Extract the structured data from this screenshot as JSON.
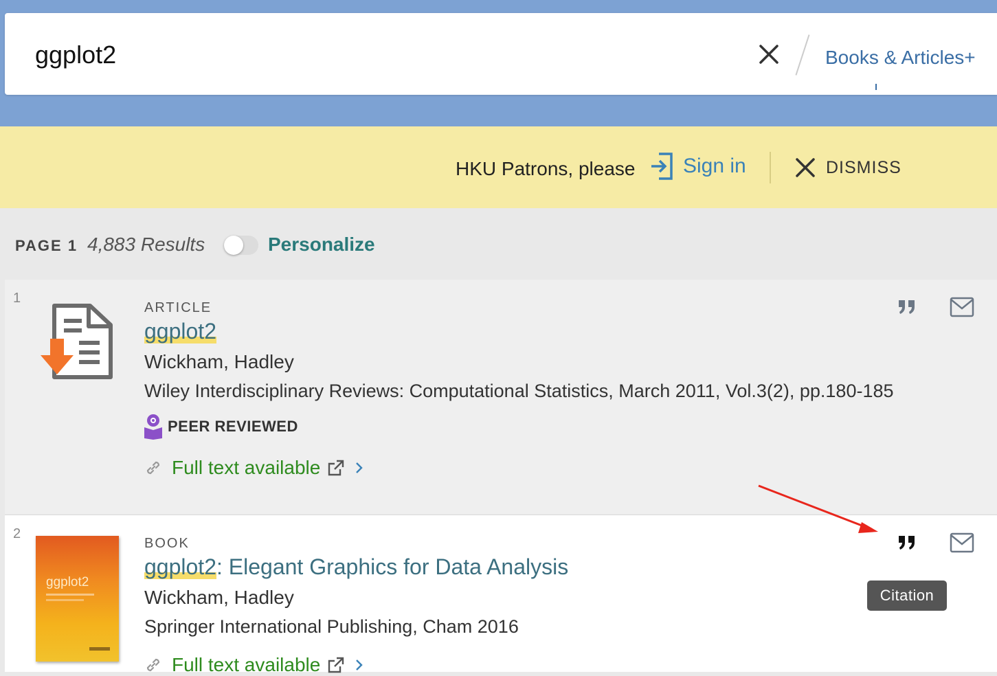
{
  "search": {
    "query": "ggplot2",
    "scope_label": "Books & Articles+"
  },
  "banner": {
    "message": "HKU Patrons, please",
    "signin_label": "Sign in",
    "dismiss_label": "DISMISS"
  },
  "results_bar": {
    "page_label": "PAGE 1",
    "results_count": "4,883 Results",
    "personalize_label": "Personalize",
    "personalize_on": false
  },
  "results": [
    {
      "number": "1",
      "type": "ARTICLE",
      "title_highlight": "ggplot2",
      "title_rest": "",
      "author": "Wickham, Hadley",
      "publication": "Wiley Interdisciplinary Reviews: Computational Statistics, March 2011, Vol.3(2), pp.180-185",
      "badge": "PEER REVIEWED",
      "availability": "Full text available"
    },
    {
      "number": "2",
      "type": "BOOK",
      "title_highlight": "ggplot2",
      "title_rest": ": Elegant Graphics for Data Analysis",
      "author": "Wickham, Hadley",
      "publication": "Springer International Publishing, Cham 2016",
      "availability": "Full text available",
      "cover_text": "ggplot2"
    }
  ],
  "tooltip": "Citation",
  "colors": {
    "header_blue": "#7da2d3",
    "banner_yellow": "#f6eba5",
    "link_teal": "#3c6f80",
    "available_green": "#2e8b1e",
    "annotation_red": "#e8261c"
  }
}
